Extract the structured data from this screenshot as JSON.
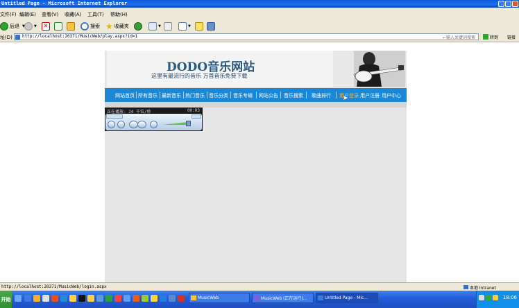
{
  "window": {
    "title": "Untitled Page - Microsoft Internet Explorer"
  },
  "menu": [
    "文件(F)",
    "编辑(E)",
    "查看(V)",
    "收藏(A)",
    "工具(T)",
    "帮助(H)"
  ],
  "toolbar": {
    "back": "后退",
    "search": "搜索",
    "favorites": "收藏夹"
  },
  "address": {
    "label": "址(D)",
    "url": "http://localhost:20371/MusicWeb/play.aspx?id=1",
    "search_hint": "←输入关键词搜索",
    "go": "转到",
    "links": "链接"
  },
  "site": {
    "title": "DODO音乐网站",
    "subtitle": "这里有最流行的音乐 万首音乐免费下载",
    "nav": [
      "网站首页",
      "所有音乐",
      "最新音乐",
      "热门音乐",
      "音乐分类",
      "音乐专辑",
      "网站公告",
      "音乐搜索",
      "歌曲排行",
      "用户登录",
      "用户注册",
      "用户中心"
    ],
    "active_nav": "用户登录"
  },
  "player": {
    "status": "正在播放: 24 千位/秒",
    "time": "00:03"
  },
  "statusbar": {
    "url": "http://localhost:20371/MusicWeb/login.aspx",
    "zone": "本地 Intranet"
  },
  "taskbar": {
    "start": "开始",
    "tasks": [
      "MusicWeb",
      "MusicWeb (正在运行)...",
      "Untitled Page - Mic..."
    ],
    "clock": "18:06"
  }
}
